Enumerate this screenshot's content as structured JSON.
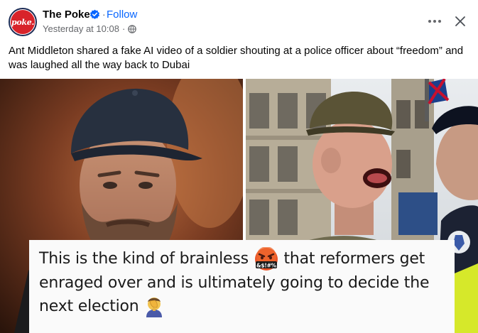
{
  "post": {
    "page_name": "The Poke",
    "avatar_text": "poke.",
    "follow_label": "Follow",
    "separator": "·",
    "timestamp": "Yesterday at 10:08",
    "timestamp_separator": "·",
    "caption": "Ant Middleton shared a fake AI video of a soldier shouting at a police officer about “freedom” and was laughed all the way back to Dubai"
  },
  "icons": {
    "verified": "verified-badge-icon",
    "audience": "globe-icon",
    "more": "more-options-icon",
    "close": "close-icon"
  },
  "tweet": {
    "line1_before": "This is the kind of brainless",
    "line1_after": "that reformers get",
    "line2": "enraged over and is ultimately going to decide the",
    "line3": "next election",
    "angry_emoji_text": "&$!#%"
  },
  "colors": {
    "accent": "#0866ff",
    "secondary_text": "#65676b",
    "brand_red": "#d8232a",
    "hi_vis": "#d6e82a"
  }
}
